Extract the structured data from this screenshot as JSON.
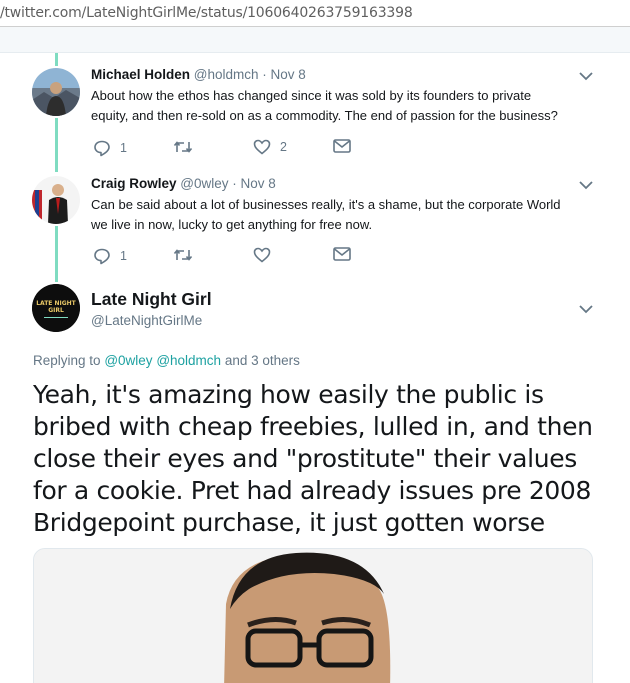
{
  "browser": {
    "url": "/twitter.com/LateNightGirlMe/status/1060640263759163398"
  },
  "tweets": [
    {
      "name": "Michael Holden",
      "meta": "@holdmch · Nov 8",
      "text_lines": [
        "About how the ethos has changed since it was sold by its founders to private",
        "equity, and then re-sold on as a commodity. The end of passion for the business?"
      ],
      "reply_count": "1",
      "like_count": "2"
    },
    {
      "name": "Craig Rowley",
      "meta": "@0wley · Nov 8",
      "text_lines": [
        "Can be said about a lot of businesses really, it's a shame, but the corporate World",
        "we live in now, lucky to get anything for free now."
      ],
      "reply_count": "1",
      "like_count": ""
    }
  ],
  "main": {
    "name": "Late Night Girl",
    "handle": "@LateNightGirlMe",
    "avatar_text": [
      "LATE NIGHT",
      "GIRL"
    ],
    "replying_prefix": "Replying to",
    "replying_mention1": "@0wley",
    "replying_mention2": "@holdmch",
    "replying_suffix": "and 3 others",
    "text_lines": [
      "Yeah, it's amazing how easily the public is",
      "bribed with cheap freebies, lulled in, and then",
      "close their eyes and \"prostitute\" their values",
      "for a cookie. Pret had already issues pre 2008",
      "Bridgepoint purchase, it just gotten worse"
    ]
  },
  "colors": {
    "thread_line": "#7fdcc1",
    "mention": "#1da1a1",
    "muted": "#657786"
  }
}
